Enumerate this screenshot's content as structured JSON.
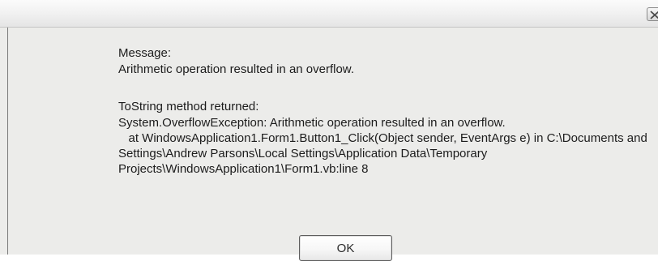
{
  "dialog": {
    "message_label": "Message:",
    "message_text": "Arithmetic operation resulted in an overflow.",
    "tostring_label": "ToString method returned:",
    "exception_lines": [
      "System.OverflowException: Arithmetic operation resulted in an overflow.",
      "   at WindowsApplication1.Form1.Button1_Click(Object sender, EventArgs e) in C:\\Documents and",
      "Settings\\Andrew Parsons\\Local Settings\\Application Data\\Temporary",
      "Projects\\WindowsApplication1\\Form1.vb:line 8"
    ],
    "ok_label": "OK"
  },
  "icons": {
    "close": "close-icon"
  }
}
